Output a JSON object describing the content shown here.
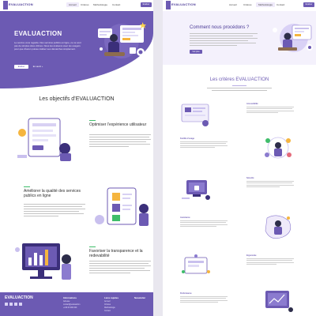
{
  "nav": {
    "logo": "EVALUACTION",
    "items": [
      "Accueil",
      "Critères",
      "Méthodologie",
      "Contact"
    ],
    "cta": "Evaluer mon"
  },
  "hero": {
    "title": "EVALUACTION",
    "text": "Le service vous regarde. Des services publics en ligne, ce ne sont pas de simples sites vitrines. Nous les évaluons avec les usagers pour que chacun puisse réaliser ses démarches simplement.",
    "button_primary": "Evaluer",
    "button_secondary": "En savoir +"
  },
  "objectives": {
    "title": "Les objectifs d’EVALUACTION",
    "items": [
      {
        "title": "Optimiser l’expérience utilisateur"
      },
      {
        "title": "Améliorer la qualité des services publics en ligne"
      },
      {
        "title": "Favoriser la transparence et la redevabilité"
      }
    ]
  },
  "footer": {
    "brand": "EVALUACTION",
    "col1_title": "Informations",
    "col1_items": [
      "Adresse",
      "contact@evaluaction",
      "+216 00 000 000"
    ],
    "col2_title": "Liens rapides",
    "col2_items": [
      "Accueil",
      "Critères",
      "Méthodologie",
      "Contact"
    ],
    "col3_title": "Newsletter"
  },
  "process": {
    "title": "Comment nous procédons ?",
    "button": "Voir plus",
    "section_title": "Les critères EVALUACTION",
    "criteria": [
      {
        "name": "Accessibilité"
      },
      {
        "name": "Facilité d’usage"
      },
      {
        "name": "Sécurité"
      },
      {
        "name": "Assistance"
      },
      {
        "name": "Ergonomie"
      },
      {
        "name": "Performance"
      }
    ]
  },
  "colors": {
    "brand": "#6c5ab3",
    "accent": "#3fbd6a",
    "text": "#2d2d2d"
  }
}
